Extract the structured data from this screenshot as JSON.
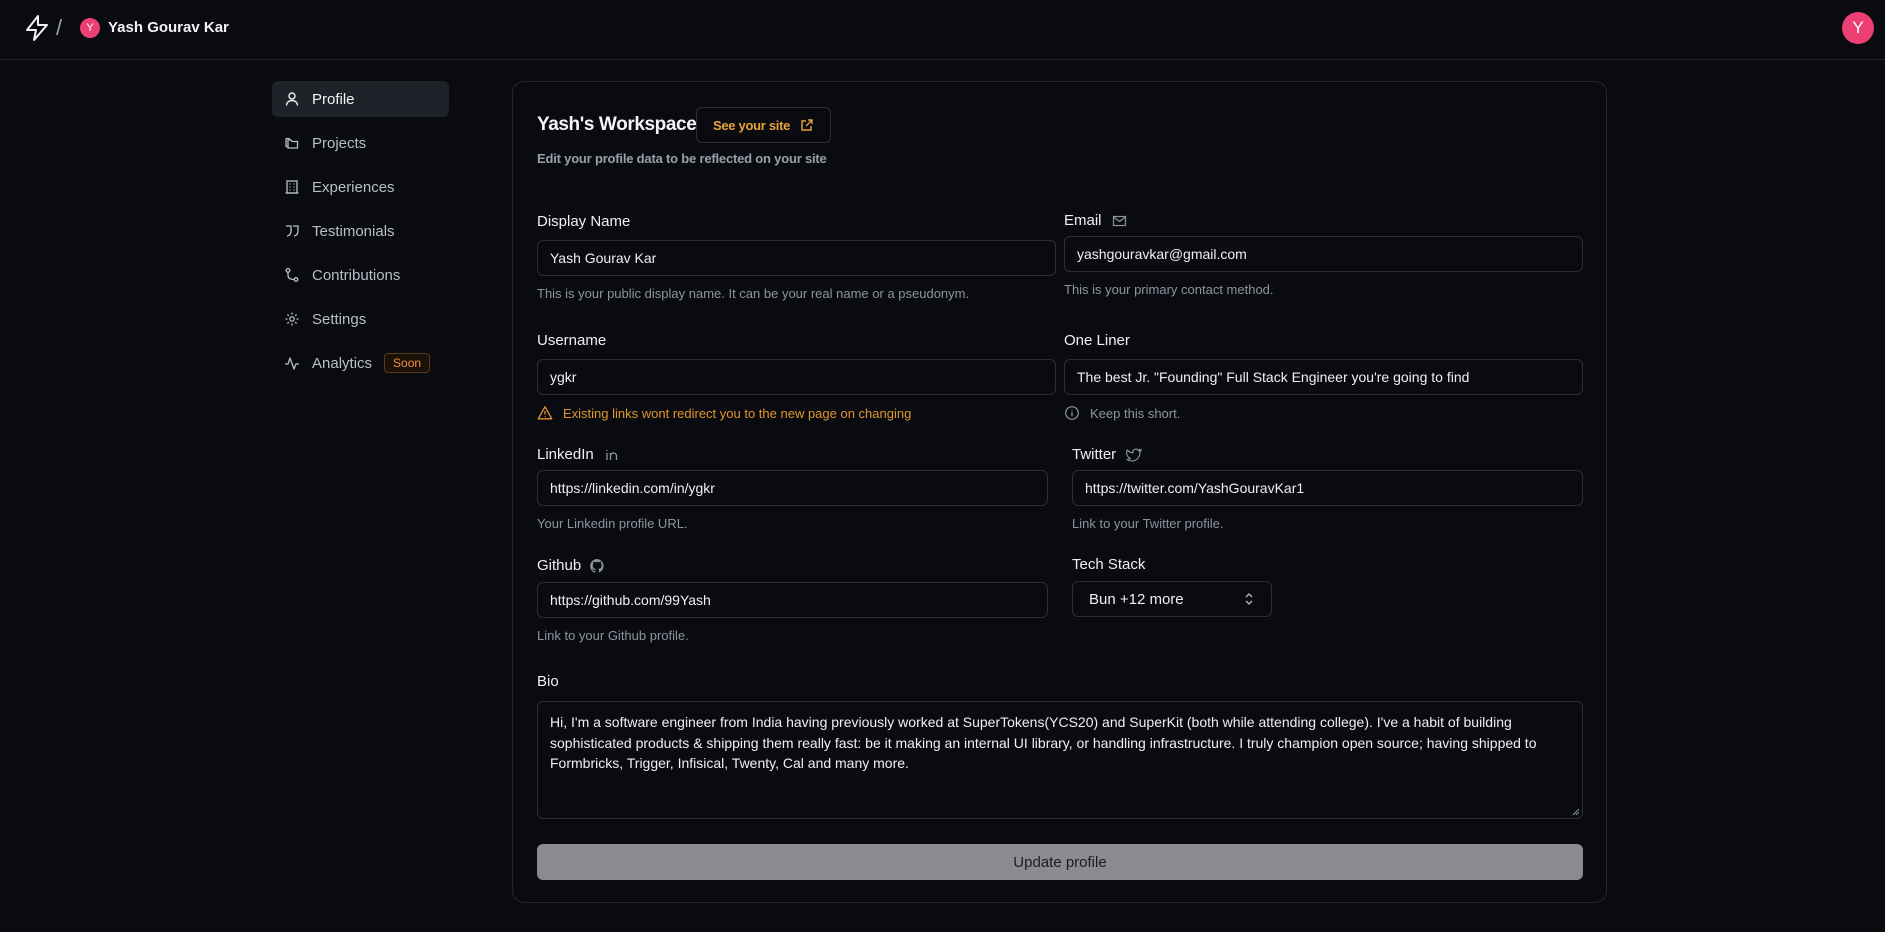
{
  "topbar": {
    "workspace_avatar_letter": "Y",
    "workspace_name": "Yash Gourav Kar",
    "separator": "/",
    "user_avatar_letter": "Y",
    "avatar_color": "#ec3f73"
  },
  "sidebar": {
    "items": [
      {
        "label": "Profile",
        "icon": "user-icon",
        "active": true
      },
      {
        "label": "Projects",
        "icon": "folders-icon"
      },
      {
        "label": "Experiences",
        "icon": "building-icon"
      },
      {
        "label": "Testimonials",
        "icon": "quote-icon"
      },
      {
        "label": "Contributions",
        "icon": "git-branch-icon"
      },
      {
        "label": "Settings",
        "icon": "gear-icon"
      },
      {
        "label": "Analytics",
        "icon": "activity-icon",
        "badge": "Soon"
      }
    ]
  },
  "workspace": {
    "title": "Yash's Workspace",
    "see_site_label": "See your site",
    "subtitle": "Edit your profile data to be reflected on your site"
  },
  "form": {
    "display_name": {
      "label": "Display Name",
      "value": "Yash Gourav Kar",
      "hint": "This is your public display name. It can be your real name or a pseudonym."
    },
    "email": {
      "label": "Email",
      "value": "yashgouravkar@gmail.com",
      "hint": "This is your primary contact method."
    },
    "username": {
      "label": "Username",
      "value": "ygkr",
      "hint": "Existing links wont redirect you to the new page on changing"
    },
    "one_liner": {
      "label": "One Liner",
      "value": "The best Jr. \"Founding\" Full Stack Engineer you're going to find",
      "hint": "Keep this short."
    },
    "linkedin": {
      "label": "LinkedIn",
      "value": "https://linkedin.com/in/ygkr",
      "hint": "Your Linkedin profile URL."
    },
    "twitter": {
      "label": "Twitter",
      "value": "https://twitter.com/YashGouravKar1",
      "hint": "Link to your Twitter profile."
    },
    "github": {
      "label": "Github",
      "value": "https://github.com/99Yash",
      "hint": "Link to your Github profile."
    },
    "tech_stack": {
      "label": "Tech Stack",
      "value": "Bun +12 more"
    },
    "bio": {
      "label": "Bio",
      "value": "Hi, I'm a software engineer from India having previously worked at SuperTokens(YCS20) and SuperKit (both while attending college). I've a habit of building sophisticated products & shipping them really fast: be it making an internal UI library, or handling infrastructure. I truly champion open source; having shipped to Formbricks, Trigger, Infisical, Twenty, Cal and many more."
    },
    "submit_label": "Update profile"
  },
  "colors": {
    "background": "#090b10",
    "accent_warning": "#e0962e",
    "border": "#2a2e36"
  }
}
